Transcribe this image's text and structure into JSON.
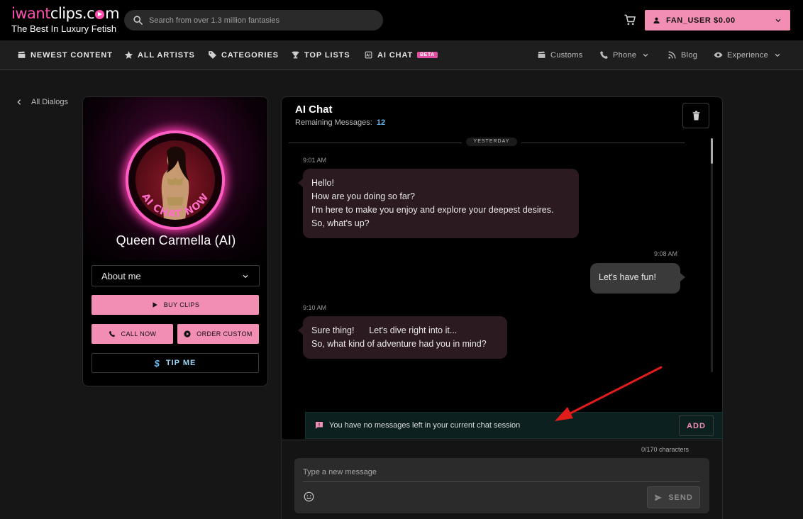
{
  "header": {
    "logo_prefix": "iwant",
    "logo_suffix": "clips.c",
    "logo_end": "m",
    "tagline": "The Best In Luxury Fetish",
    "search_placeholder": "Search from over 1.3 million fantasies",
    "user_label": "FAN_USER $0.00"
  },
  "nav": {
    "items": [
      {
        "label": "NEWEST CONTENT",
        "icon": "clapperboard-icon"
      },
      {
        "label": "ALL ARTISTS",
        "icon": "star-icon"
      },
      {
        "label": "CATEGORIES",
        "icon": "tag-icon"
      },
      {
        "label": "TOP LISTS",
        "icon": "trophy-icon"
      },
      {
        "label": "AI CHAT",
        "icon": "ai-icon",
        "badge": "BETA"
      }
    ],
    "right_items": [
      {
        "label": "Customs",
        "icon": "clapperboard-icon"
      },
      {
        "label": "Phone",
        "icon": "phone-icon"
      },
      {
        "label": "Blog",
        "icon": "rss-icon"
      },
      {
        "label": "Experience",
        "icon": "eye-icon"
      }
    ]
  },
  "back_link": "All Dialogs",
  "profile": {
    "ring_text": "AI CHAT NOW",
    "name": "Queen Carmella (AI)",
    "about_label": "About me",
    "buy_label": "BUY CLIPS",
    "call_label": "CALL NOW",
    "order_label": "ORDER CUSTOM",
    "tip_label": "TIP ME"
  },
  "chat": {
    "title": "AI Chat",
    "remaining_label": "Remaining Messages:",
    "remaining_count": "12",
    "day_label": "YESTERDAY",
    "messages": [
      {
        "from": "ai",
        "time": "9:01 AM",
        "lines": [
          "Hello!",
          "How are you doing so far?",
          "I'm here to make you enjoy and explore your deepest desires.",
          "So, what's up?"
        ]
      },
      {
        "from": "me",
        "time": "9:08 AM",
        "lines": [
          "Let's have fun!"
        ]
      },
      {
        "from": "ai",
        "time": "9:10 AM",
        "lines": [
          "Sure thing!      Let's dive right into it...",
          "So, what kind of adventure had you in mind?"
        ]
      }
    ],
    "notice": "You have no messages left in your current chat session",
    "add_label": "ADD",
    "char_count": "0/170 characters",
    "input_placeholder": "Type a new message",
    "send_label": "SEND"
  },
  "colors": {
    "accent_pink": "#f28db4",
    "logo_pink": "#ff4fae",
    "link_blue": "#6bb9f0",
    "annotation_red": "#e21b1b"
  }
}
